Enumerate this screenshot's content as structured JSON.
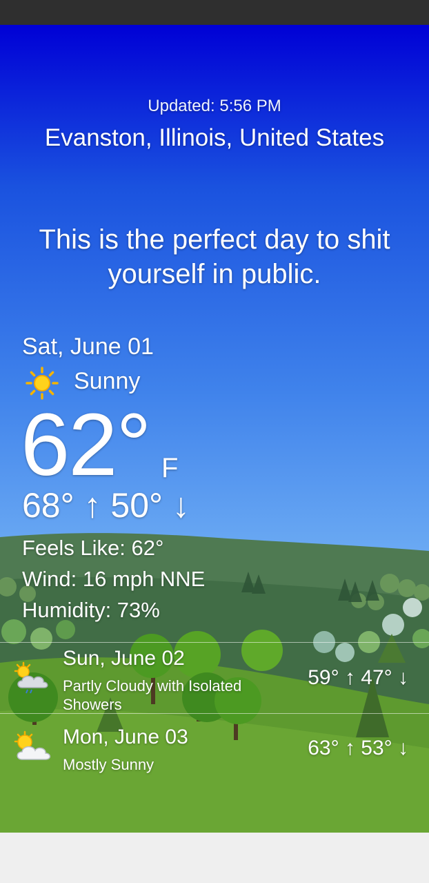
{
  "header": {
    "updated": "Updated: 5:56 PM",
    "location": "Evanston, Illinois, United States"
  },
  "tagline": "This is the perfect day to shit yourself in public.",
  "today": {
    "date": "Sat, June 01",
    "condition": "Sunny",
    "icon": "sun-icon",
    "temperature": "62°",
    "unit": "F",
    "high_low": "68° ↑ 50° ↓",
    "feels_like": "Feels Like: 62°",
    "wind": "Wind: 16 mph NNE",
    "humidity": "Humidity: 73%"
  },
  "forecast": [
    {
      "date": "Sun, June 02",
      "condition": "Partly Cloudy with Isolated Showers",
      "high_low": "59° ↑ 47° ↓",
      "icon": "partly-cloudy-showers-icon"
    },
    {
      "date": "Mon, June 03",
      "condition": "Mostly Sunny",
      "high_low": "63° ↑ 53° ↓",
      "icon": "mostly-sunny-icon"
    }
  ],
  "colors": {
    "sky_top": "#0000d6",
    "sky_bottom": "#8ec6f7",
    "grass": "#5f9b2e",
    "status_bar": "#2f2f2f"
  }
}
